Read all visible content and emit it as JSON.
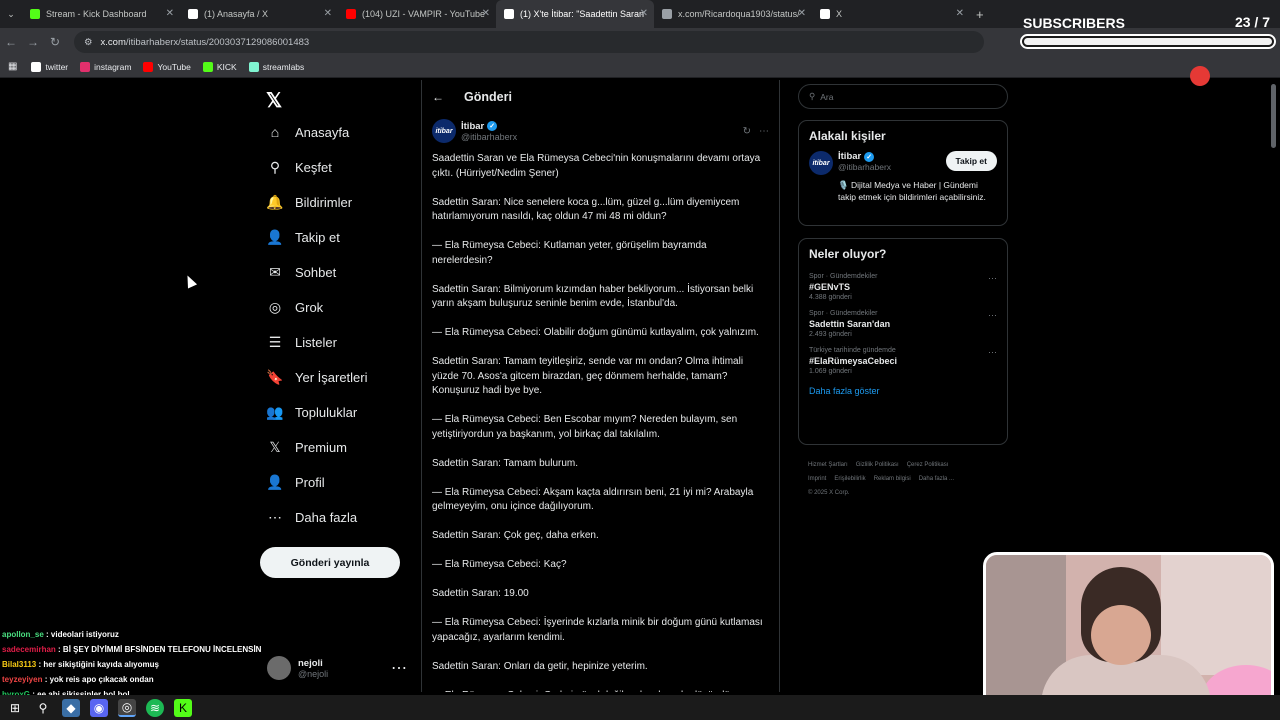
{
  "browser": {
    "tabs": [
      {
        "title": "Stream - Kick Dashboard",
        "icon": "kick-icon",
        "color": "#53fc18"
      },
      {
        "title": "(1) Anasayfa / X",
        "icon": "x-icon",
        "color": "#ffffff"
      },
      {
        "title": "(104) UZI - VAMPIR - YouTube",
        "icon": "youtube-icon",
        "color": "#ff0000"
      },
      {
        "title": "(1) X'te İtibar: \"Saadettin Saran",
        "icon": "x-icon",
        "color": "#ffffff",
        "active": true
      },
      {
        "title": "x.com/Ricardoqua1903/status/",
        "icon": "globe-icon",
        "color": "#9aa0a6"
      },
      {
        "title": "X",
        "icon": "x-icon",
        "color": "#ffffff"
      }
    ],
    "url_host": "x.com",
    "url_path": "/itibarhaberx/status/2003037129086001483",
    "bookmarks": [
      {
        "label": "twitter",
        "color": "#ffffff"
      },
      {
        "label": "instagram",
        "color": "#e1306c"
      },
      {
        "label": "YouTube",
        "color": "#ff0000"
      },
      {
        "label": "KICK",
        "color": "#53fc18"
      },
      {
        "label": "streamlabs",
        "color": "#80f5d2"
      }
    ]
  },
  "subscribers": {
    "label": "SUBSCRIBERS",
    "count": "23 / 7",
    "progress": 1.0
  },
  "sidebar": {
    "items": [
      {
        "label": "Anasayfa",
        "icon": "home-icon",
        "glyph": "⌂"
      },
      {
        "label": "Keşfet",
        "icon": "search-icon",
        "glyph": "⚲"
      },
      {
        "label": "Bildirimler",
        "icon": "bell-icon",
        "glyph": "🔔"
      },
      {
        "label": "Takip et",
        "icon": "add-person-icon",
        "glyph": "👤"
      },
      {
        "label": "Sohbet",
        "icon": "mail-icon",
        "glyph": "✉"
      },
      {
        "label": "Grok",
        "icon": "grok-icon",
        "glyph": "◎"
      },
      {
        "label": "Listeler",
        "icon": "list-icon",
        "glyph": "☰"
      },
      {
        "label": "Yer İşaretleri",
        "icon": "bookmark-icon",
        "glyph": "🔖"
      },
      {
        "label": "Topluluklar",
        "icon": "communities-icon",
        "glyph": "👥"
      },
      {
        "label": "Premium",
        "icon": "x-icon",
        "glyph": "𝕏"
      },
      {
        "label": "Profil",
        "icon": "profile-icon",
        "glyph": "👤"
      },
      {
        "label": "Daha fazla",
        "icon": "more-icon",
        "glyph": "⋯"
      }
    ],
    "post_button": "Gönderi yayınla",
    "profile": {
      "name": "nejoli",
      "handle": "@nejoli"
    }
  },
  "main": {
    "header": "Gönderi",
    "author": {
      "name": "İtibar",
      "handle": "@itibarhaberx",
      "logo_text": "itibar"
    },
    "paragraphs": [
      "Saadettin Saran ve Ela Rümeysa Cebeci'nin konuşmalarını devamı ortaya çıktı. (Hürriyet/Nedim Şener)",
      "Sadettin Saran: Nice senelere koca g...lüm, güzel g...lüm diyemiycem hatırlamıyorum nasıldı, kaç oldun 47 mi 48 mi oldun?",
      "— Ela Rümeysa Cebeci: Kutlaman yeter, görüşelim bayramda nerelerdesin?",
      "Sadettin Saran: Bilmiyorum kızımdan haber bekliyorum... İstiyorsan belki yarın akşam buluşuruz seninle benim evde, İstanbul'da.",
      "— Ela Rümeysa Cebeci: Olabilir doğum günümü kutlayalım, çok yalnızım.",
      "Sadettin Saran: Tamam teyitleşiriz, sende var mı ondan? Olma ihtimali yüzde 70. Asos'a gitcem birazdan, geç dönmem herhalde, tamam? Konuşuruz hadi bye bye.",
      "— Ela Rümeysa Cebeci: Ben Escobar mıyım? Nereden bulayım, sen yetiştiriyordun ya başkanım, yol birkaç dal takılalım.",
      "Sadettin Saran: Tamam bulurum.",
      "— Ela Rümeysa Cebeci: Akşam kaçta aldırırsın beni, 21 iyi mi? Arabayla gelmeyeyim, onu içince dağılıyorum.",
      "Sadettin Saran: Çok geç, daha erken.",
      "— Ela Rümeysa Cebeci: Kaç?",
      "Sadettin Saran: 19.00",
      "— Ela Rümeysa Cebeci: İşyerinde kızlarla minik bir doğum günü kutlaması yapacağız, ayarlarım kendimi.",
      "Sadettin Saran: Onları da getir, hepinize yeterim.",
      "— Ela Rümeysa Cebeci: G...leri güzel değil, yoksa ben de düşündüm..."
    ]
  },
  "right": {
    "search_placeholder": "Ara",
    "related_title": "Alakalı kişiler",
    "related": {
      "name": "İtibar",
      "handle": "@itibarhaberx",
      "follow": "Takip et",
      "bio": "🎙️ Dijital Medya ve Haber | Gündemi takip etmek için bildirimleri açabilirsiniz."
    },
    "trends_title": "Neler oluyor?",
    "trends": [
      {
        "context": "Spor · Gündemdekiler",
        "title": "#GENvTS",
        "count": "4.388 gönderi"
      },
      {
        "context": "Spor · Gündemdekiler",
        "title": "Sadettin Saran'dan",
        "count": "2.493 gönderi"
      },
      {
        "context": "Türkiye tarihinde gündemde",
        "title": "#ElaRümeysaCebeci",
        "count": "1.069 gönderi"
      }
    ],
    "show_more": "Daha fazla göster",
    "footer": [
      "Hizmet Şartları",
      "Gizlilik Politikası",
      "Çerez Politikası",
      "Imprint",
      "Erişilebilirlik",
      "Reklam bilgisi",
      "Daha fazla ...",
      "© 2025 X Corp."
    ]
  },
  "chat": [
    {
      "user": "apollon_se",
      "msg": "videolari istiyoruz",
      "color": "#4ade80"
    },
    {
      "user": "sadecemirhan",
      "msg": "Bİ ŞEY DİYİMMİ BFSİNDEN TELEFONU İNCELENSİN",
      "color": "#e11d48"
    },
    {
      "user": "Bilal3113",
      "msg": "her sikiştiğini kayıda alıyomuş",
      "color": "#facc15"
    },
    {
      "user": "teyzeyiyen",
      "msg": "yok reis apo çıkacak ondan",
      "color": "#ef4444"
    },
    {
      "user": "hyroxG",
      "msg": "ee abi sikişsinler bol bol",
      "color": "#22c55e"
    }
  ]
}
